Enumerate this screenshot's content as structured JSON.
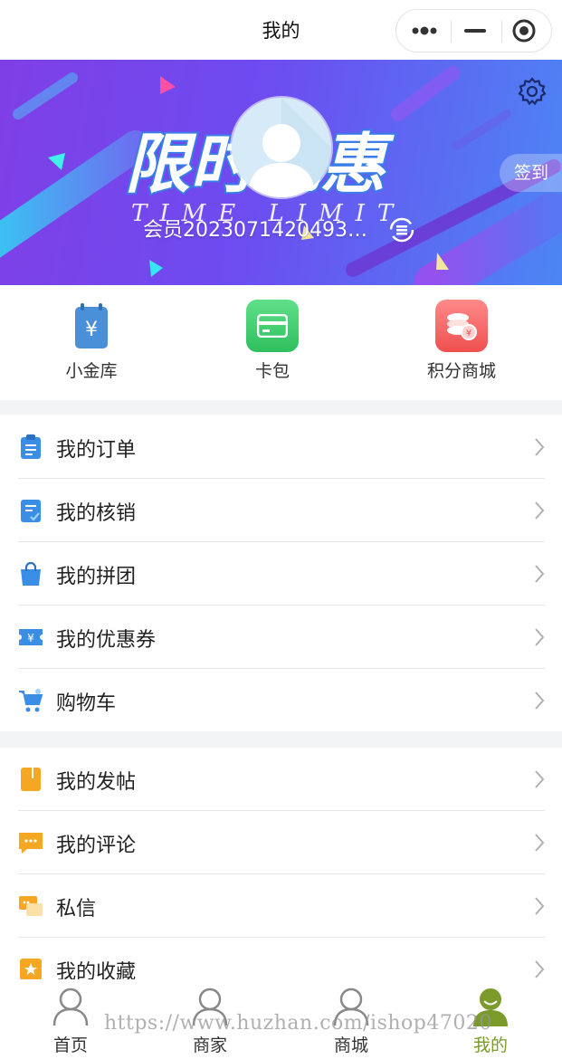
{
  "nav": {
    "title": "我的",
    "more_icon": "more-dots-icon",
    "minimize_icon": "minimize-icon",
    "close_icon": "target-close-icon"
  },
  "banner": {
    "art_title": "限时优惠",
    "art_subtitle": "TIME LIMIT",
    "nickname": "会员2023071420493…",
    "signin_label": "签到",
    "settings_icon": "gear-icon",
    "refresh_icon": "refresh-icon"
  },
  "quick": [
    {
      "label": "小金库",
      "icon": "wallet-yen-icon",
      "color": "#4a90d9"
    },
    {
      "label": "卡包",
      "icon": "card-icon",
      "color": "#3cc86a"
    },
    {
      "label": "积分商城",
      "icon": "coins-icon",
      "color": "#f25c5c"
    }
  ],
  "menu_group_1": [
    {
      "label": "我的订单",
      "icon": "order-clipboard-icon"
    },
    {
      "label": "我的核销",
      "icon": "verify-doc-icon"
    },
    {
      "label": "我的拼团",
      "icon": "group-bag-icon"
    },
    {
      "label": "我的优惠券",
      "icon": "coupon-icon"
    },
    {
      "label": "购物车",
      "icon": "cart-icon"
    }
  ],
  "menu_group_2": [
    {
      "label": "我的发帖",
      "icon": "post-icon"
    },
    {
      "label": "我的评论",
      "icon": "comment-icon"
    },
    {
      "label": "私信",
      "icon": "message-icon"
    },
    {
      "label": "我的收藏",
      "icon": "favorite-icon"
    }
  ],
  "tabs": [
    {
      "label": "首页",
      "icon": "person-outline-icon"
    },
    {
      "label": "商家",
      "icon": "person-outline-icon"
    },
    {
      "label": "商城",
      "icon": "person-outline-icon"
    },
    {
      "label": "我的",
      "icon": "person-filled-icon",
      "active": true
    }
  ],
  "watermark": "https://www.huzhan.com/ishop47020",
  "colors": {
    "accent_blue": "#3a8ee6",
    "accent_orange": "#f5a623",
    "active_tab": "#7a9a2a"
  }
}
